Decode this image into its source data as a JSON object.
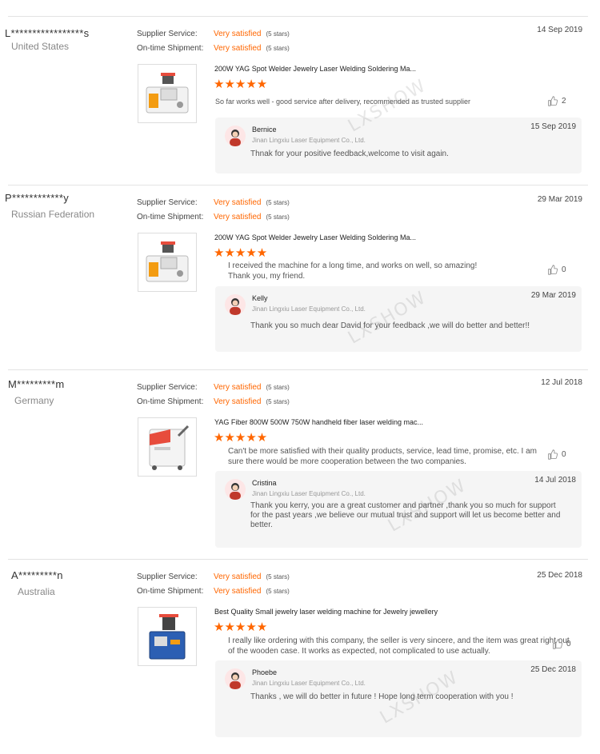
{
  "labels": {
    "supplier_service": "Supplier Service:",
    "ontime_shipment": "On-time Shipment:"
  },
  "watermark": "LXSHOW",
  "reviews": [
    {
      "buyer": "L*****************s",
      "country": "United States",
      "supplier_value": "Very satisfied",
      "supplier_stars": "(5 stars)",
      "shipment_value": "Very satisfied",
      "shipment_stars": "(5 stars)",
      "date": "14 Sep 2019",
      "product_title": "200W YAG Spot Welder Jewelry Laser Welding Soldering Ma...",
      "rating": "★★★★★",
      "comment": "So far works well - good service after delivery, recommended as trusted supplier",
      "likes": "2",
      "reply": {
        "name": "Bernice",
        "company": "Jinan Lingxiu Laser Equipment Co., Ltd.",
        "date": "15 Sep 2019",
        "text": "Thnak for your positive feedback,welcome to visit again."
      }
    },
    {
      "buyer": "P************y",
      "country": "Russian Federation",
      "supplier_value": "Very satisfied",
      "supplier_stars": "(5 stars)",
      "shipment_value": "Very satisfied",
      "shipment_stars": "(5 stars)",
      "date": "29 Mar 2019",
      "product_title": "200W YAG Spot Welder Jewelry Laser Welding Soldering Ma...",
      "rating": "★★★★★",
      "comment": "I received the machine for a long time, and works on well, so amazing!\nThank you, my friend.",
      "likes": "0",
      "reply": {
        "name": "Kelly",
        "company": "Jinan Lingxiu Laser Equipment Co., Ltd.",
        "date": "29 Mar 2019",
        "text": "Thank you so much dear David for your feedback ,we will do better and better!!"
      }
    },
    {
      "buyer": "M*********m",
      "country": "Germany",
      "supplier_value": "Very satisfied",
      "supplier_stars": "(5 stars)",
      "shipment_value": "Very satisfied",
      "shipment_stars": "(5 stars)",
      "date": "12 Jul 2018",
      "product_title": "YAG Fiber 800W 500W 750W handheld fiber laser welding mac...",
      "rating": "★★★★★",
      "comment": "Can't be more satisfied with their quality products, service, lead time, promise, etc. I am sure there would be more cooperation between the two companies.",
      "likes": "0",
      "reply": {
        "name": "Cristina",
        "company": "Jinan Lingxiu Laser Equipment Co., Ltd.",
        "date": "14 Jul 2018",
        "text": "Thank you kerry, you are a great customer and partner ,thank you so much for support for the past years ,we believe our mutual trust and support will let us become better and better."
      }
    },
    {
      "buyer": "A*********n",
      "country": "Australia",
      "supplier_value": "Very satisfied",
      "supplier_stars": "(5 stars)",
      "shipment_value": "Very satisfied",
      "shipment_stars": "(5 stars)",
      "date": "25 Dec 2018",
      "product_title": "Best Quality Small jewelry laser welding machine for Jewelry jewellery",
      "rating": "★★★★★",
      "comment": "I really like ordering with this company, the seller is very sincere, and the item was great right out of the wooden case. It works as expected, not complicated to use actually.",
      "likes": "0",
      "reply": {
        "name": "Phoebe",
        "company": "Jinan Lingxiu Laser Equipment Co., Ltd.",
        "date": "25 Dec 2018",
        "text": "Thanks , we will do better in future !  Hope long term cooperation with you !"
      }
    }
  ]
}
